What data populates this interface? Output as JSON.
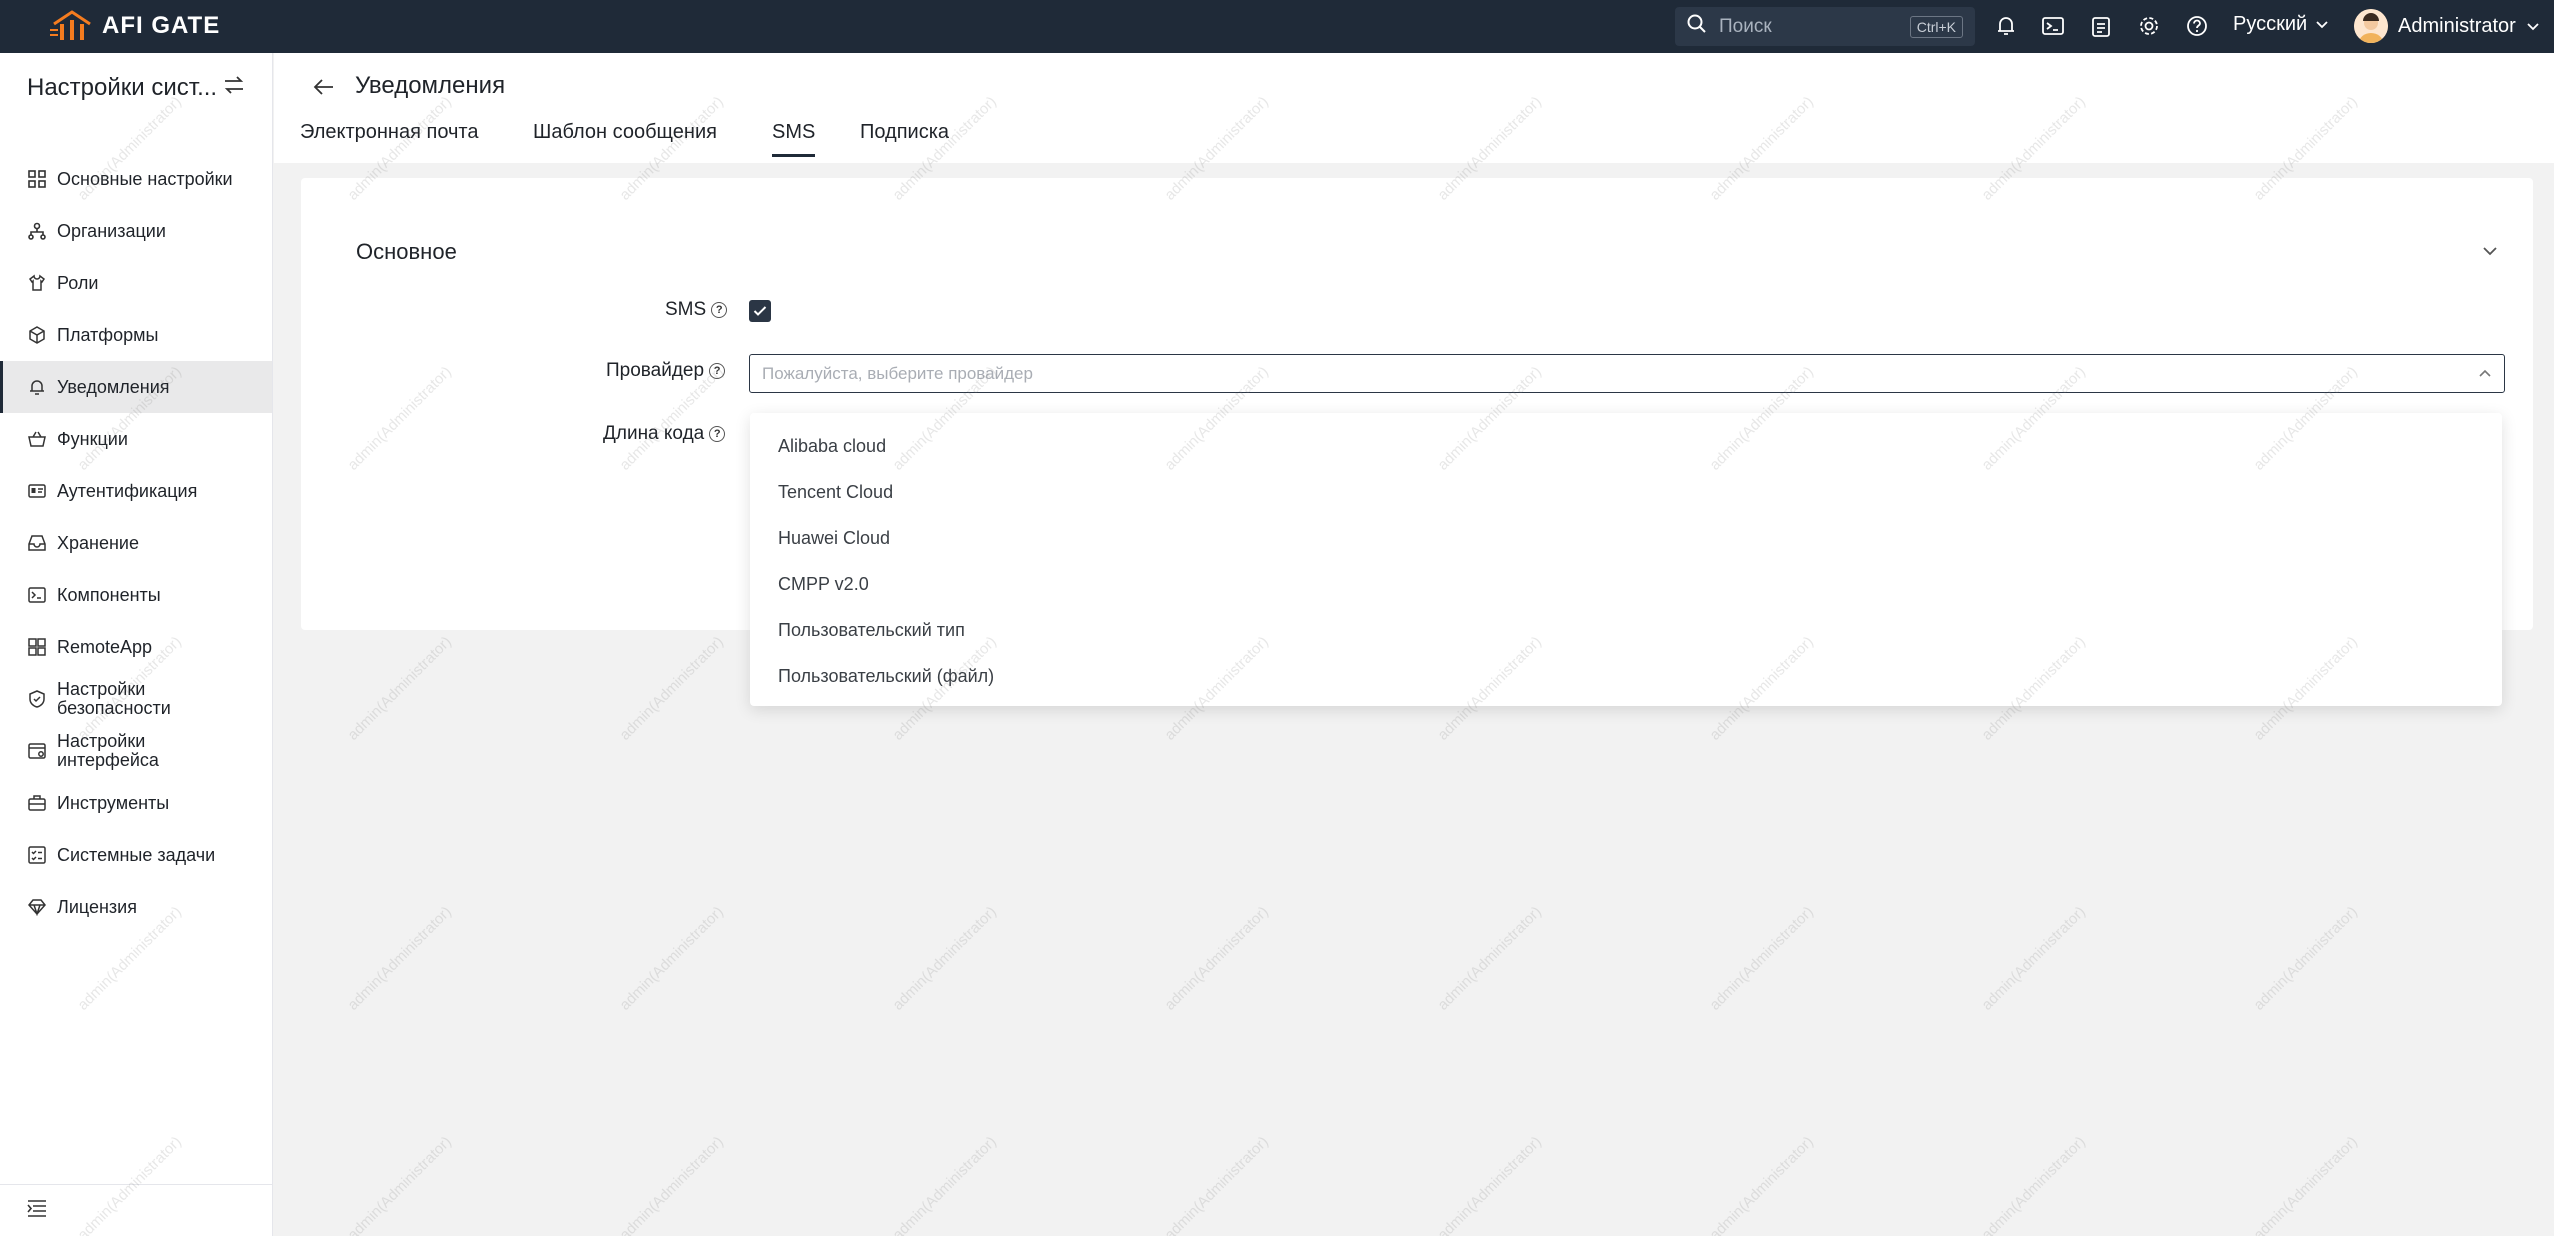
{
  "app": {
    "name": "AFI GATE"
  },
  "topbar": {
    "search_placeholder": "Поиск",
    "search_shortcut": "Ctrl+K",
    "language": "Русский",
    "user": "Administrator"
  },
  "sidebar": {
    "title": "Настройки сист...",
    "items": [
      {
        "label": "Основные настройки",
        "icon": "grid-icon"
      },
      {
        "label": "Организации",
        "icon": "org-icon"
      },
      {
        "label": "Роли",
        "icon": "shirt-icon"
      },
      {
        "label": "Платформы",
        "icon": "cube-icon"
      },
      {
        "label": "Уведомления",
        "icon": "bell-icon",
        "active": true
      },
      {
        "label": "Функции",
        "icon": "basket-icon"
      },
      {
        "label": "Аутентификация",
        "icon": "id-card-icon"
      },
      {
        "label": "Хранение",
        "icon": "inbox-icon"
      },
      {
        "label": "Компоненты",
        "icon": "terminal-icon"
      },
      {
        "label": "RemoteApp",
        "icon": "apps-icon"
      },
      {
        "label": "Настройки безопасности",
        "icon": "shield-icon"
      },
      {
        "label": "Настройки интерфейса",
        "icon": "window-icon"
      },
      {
        "label": "Инструменты",
        "icon": "toolbox-icon"
      },
      {
        "label": "Системные задачи",
        "icon": "tasks-icon"
      },
      {
        "label": "Лицензия",
        "icon": "diamond-icon"
      }
    ]
  },
  "header": {
    "title": "Уведомления",
    "tabs": [
      "Электронная почта",
      "Шаблон сообщения",
      "SMS",
      "Подписка"
    ],
    "active_tab": "SMS"
  },
  "form": {
    "section": "Основное",
    "sms_label": "SMS",
    "sms_checked": true,
    "provider_label": "Провайдер",
    "provider_placeholder": "Пожалуйста, выберите провайдер",
    "code_length_label": "Длина кода"
  },
  "dropdown": {
    "options": [
      "Alibaba cloud",
      "Tencent Cloud",
      "Huawei Cloud",
      "CMPP v2.0",
      "Пользовательский тип",
      "Пользовательский (файл)"
    ]
  },
  "watermark": "admin(Administrator)",
  "colors": {
    "topbar": "#1f2a38",
    "accent": "#f57c1f",
    "active_bg": "#e9e9ea"
  }
}
